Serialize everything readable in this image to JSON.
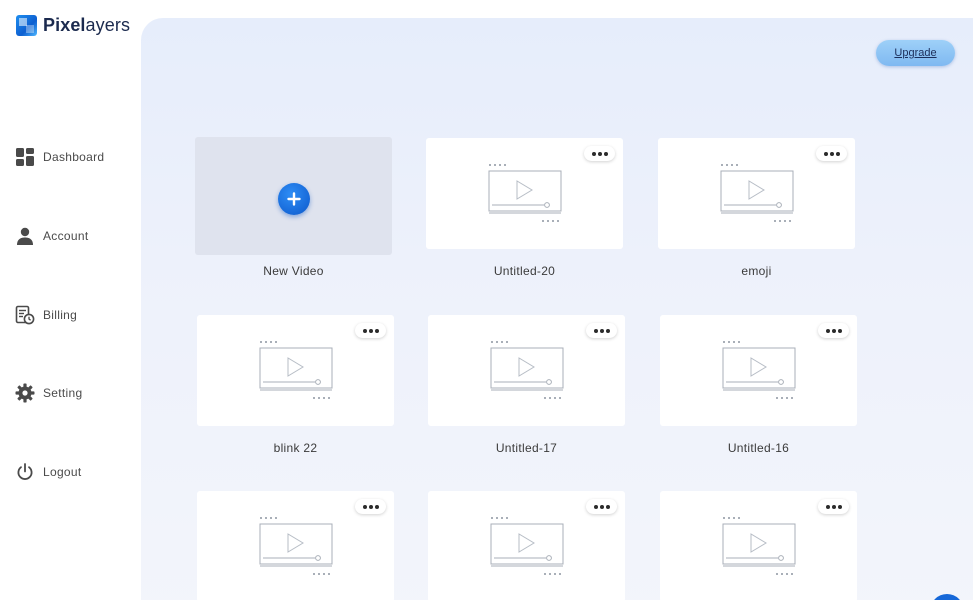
{
  "brand": {
    "name_bold": "Pixel",
    "name_light": "ayers",
    "name_bold2": ""
  },
  "sidebar": {
    "items": [
      {
        "label": "Dashboard",
        "icon": "dashboard-icon"
      },
      {
        "label": "Account",
        "icon": "user-icon"
      },
      {
        "label": "Billing",
        "icon": "billing-icon"
      },
      {
        "label": "Setting",
        "icon": "gear-icon"
      },
      {
        "label": "Logout",
        "icon": "power-icon"
      }
    ]
  },
  "header": {
    "upgrade_label": "Upgrade"
  },
  "new_video": {
    "label": "New Video"
  },
  "projects": [
    {
      "title": "Untitled-20"
    },
    {
      "title": "emoji"
    },
    {
      "title": "blink 22"
    },
    {
      "title": "Untitled-17"
    },
    {
      "title": "Untitled-16"
    },
    {
      "title": ""
    },
    {
      "title": ""
    },
    {
      "title": ""
    }
  ],
  "colors": {
    "accent": "#1668d8",
    "upgrade": "#8ec5f5",
    "main_bg": "#e9effb"
  }
}
